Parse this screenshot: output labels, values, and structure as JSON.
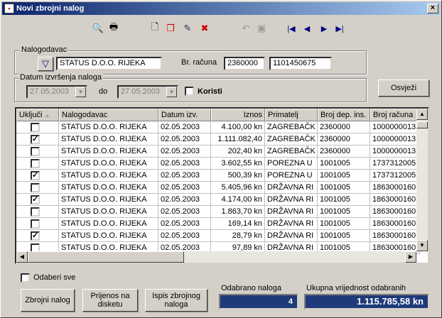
{
  "window": {
    "title": "Novi zbrojni nalog",
    "close_glyph": "×"
  },
  "toolbar": {
    "icons": [
      "find-record-icon",
      "print-icon",
      "new-document-icon",
      "copy-document-icon",
      "edit-document-icon",
      "delete-document-icon",
      "undo-icon",
      "save-icon",
      "first-record-icon",
      "prev-record-icon",
      "next-record-icon",
      "last-record-icon"
    ]
  },
  "nalogodavac": {
    "group_label": "Nalogodavac",
    "name_value": "STATUS D.O.O. RIJEKA",
    "br_racuna_label": "Br. računa",
    "account1": "2360000",
    "account2": "1101450675"
  },
  "datum": {
    "group_label": "Datum izvršenja naloga",
    "from": "27.05.2003",
    "do_label": "do",
    "to": "27.05.2003",
    "koristi_label": "Koristi"
  },
  "osvjezi_label": "Osvježi",
  "grid": {
    "columns": [
      "Uključi",
      "Nalogodavac",
      "Datum izv.",
      "Iznos",
      "Primatelj",
      "Broj dep. ins.",
      "Broj računa"
    ],
    "rows": [
      {
        "checked": false,
        "nalogodavac": "STATUS D.O.O. RIJEKA",
        "datum": "02.05.2003",
        "iznos": "4.100,00 kn",
        "primatelj": "ZAGREBAČK",
        "dep": "2360000",
        "racun": "1000000013"
      },
      {
        "checked": true,
        "nalogodavac": "STATUS D.O.O. RIJEKA",
        "datum": "02.05.2003",
        "iznos": "1.111.082,40",
        "primatelj": "ZAGREBAČK",
        "dep": "2360000",
        "racun": "1000000013"
      },
      {
        "checked": false,
        "nalogodavac": "STATUS D.O.O. RIJEKA",
        "datum": "02.05.2003",
        "iznos": "202,40 kn",
        "primatelj": "ZAGREBAČK",
        "dep": "2360000",
        "racun": "1000000013"
      },
      {
        "checked": false,
        "nalogodavac": "STATUS D.O.O. RIJEKA",
        "datum": "02.05.2003",
        "iznos": "3.602,55 kn",
        "primatelj": "POREZNA U",
        "dep": "1001005",
        "racun": "1737312005"
      },
      {
        "checked": true,
        "nalogodavac": "STATUS D.O.O. RIJEKA",
        "datum": "02.05.2003",
        "iznos": "500,39 kn",
        "primatelj": "POREZNA U",
        "dep": "1001005",
        "racun": "1737312005"
      },
      {
        "checked": false,
        "nalogodavac": "STATUS D.O.O. RIJEKA",
        "datum": "02.05.2003",
        "iznos": "5.405,96 kn",
        "primatelj": "DRŽAVNA RI",
        "dep": "1001005",
        "racun": "1863000160"
      },
      {
        "checked": true,
        "nalogodavac": "STATUS D.O.O. RIJEKA",
        "datum": "02.05.2003",
        "iznos": "4.174,00 kn",
        "primatelj": "DRŽAVNA RI",
        "dep": "1001005",
        "racun": "1863000160"
      },
      {
        "checked": false,
        "nalogodavac": "STATUS D.O.O. RIJEKA",
        "datum": "02.05.2003",
        "iznos": "1.863,70 kn",
        "primatelj": "DRŽAVNA RI",
        "dep": "1001005",
        "racun": "1863000160"
      },
      {
        "checked": false,
        "nalogodavac": "STATUS D.O.O. RIJEKA",
        "datum": "02.05.2003",
        "iznos": "169,14 kn",
        "primatelj": "DRŽAVNA RI",
        "dep": "1001005",
        "racun": "1863000160"
      },
      {
        "checked": true,
        "nalogodavac": "STATUS D.O.O. RIJEKA",
        "datum": "02.05.2003",
        "iznos": "28,79 kn",
        "primatelj": "DRŽAVNA RI",
        "dep": "1001005",
        "racun": "1863000160"
      },
      {
        "checked": false,
        "nalogodavac": "STATUS D.O.O. RIJEKA",
        "datum": "02.05.2003",
        "iznos": "97,89 kn",
        "primatelj": "DRŽAVNA RI",
        "dep": "1001005",
        "racun": "1863000160"
      }
    ]
  },
  "odaberi_sve_label": "Odaberi sve",
  "buttons": {
    "zbrojni": "Zbrojni nalog",
    "prijenos": "Prijenos na disketu",
    "ispis": "Ispis zbrojnog naloga"
  },
  "summary": {
    "odabrano_label": "Odabrano naloga",
    "odabrano_value": "4",
    "ukupna_label": "Ukupna vrijednost odabranih",
    "ukupna_value": "1.115.785,58 kn"
  },
  "colors": {
    "title_start": "#0a246a",
    "title_end": "#a6caf0",
    "panel": "#1f3a7a"
  }
}
